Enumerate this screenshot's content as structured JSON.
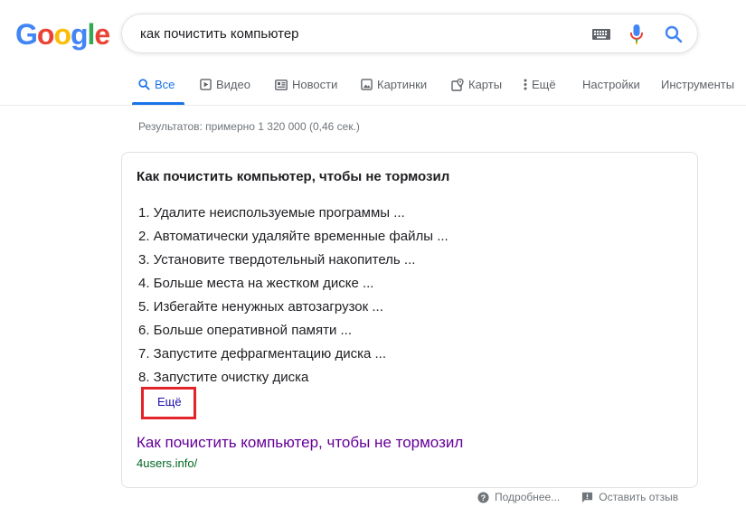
{
  "logo": {
    "letters": [
      "G",
      "o",
      "o",
      "g",
      "l",
      "e"
    ],
    "colors": [
      "#4285f4",
      "#ea4335",
      "#fbbc05",
      "#4285f4",
      "#34a853",
      "#ea4335"
    ]
  },
  "search": {
    "query": "как почистить компьютер"
  },
  "tabs": [
    {
      "label": "Все",
      "icon": "search-icon"
    },
    {
      "label": "Видео",
      "icon": "play-icon"
    },
    {
      "label": "Новости",
      "icon": "news-icon"
    },
    {
      "label": "Картинки",
      "icon": "image-icon"
    },
    {
      "label": "Карты",
      "icon": "map-icon"
    },
    {
      "label": "Ещё",
      "icon": "more-vert-icon"
    },
    {
      "label": "Настройки"
    },
    {
      "label": "Инструменты"
    }
  ],
  "results_stats": "Результатов: примерно 1 320 000 (0,46 сек.)",
  "snippet": {
    "title": "Как почистить компьютер, чтобы не тормозил",
    "items": [
      "1. Удалите неиспользуемые программы ...",
      "2. Автоматически удаляйте временные файлы ...",
      "3. Установите твердотельный накопитель ...",
      "4. Больше места на жестком диске ...",
      "5. Избегайте ненужных автозагрузок ...",
      "6. Больше оперативной памяти ...",
      "7. Запустите дефрагментацию диска ...",
      "8. Запустите очистку диска"
    ],
    "more_label": "Ещё",
    "link_title": "Как почистить компьютер, чтобы не тормозил",
    "link_url": "4users.info/"
  },
  "footer": {
    "details": "Подробнее...",
    "feedback": "Оставить отзыв"
  },
  "colors": {
    "accent": "#1a73e8",
    "link": "#660099",
    "url": "#006621",
    "highlight": "#e3242b"
  }
}
